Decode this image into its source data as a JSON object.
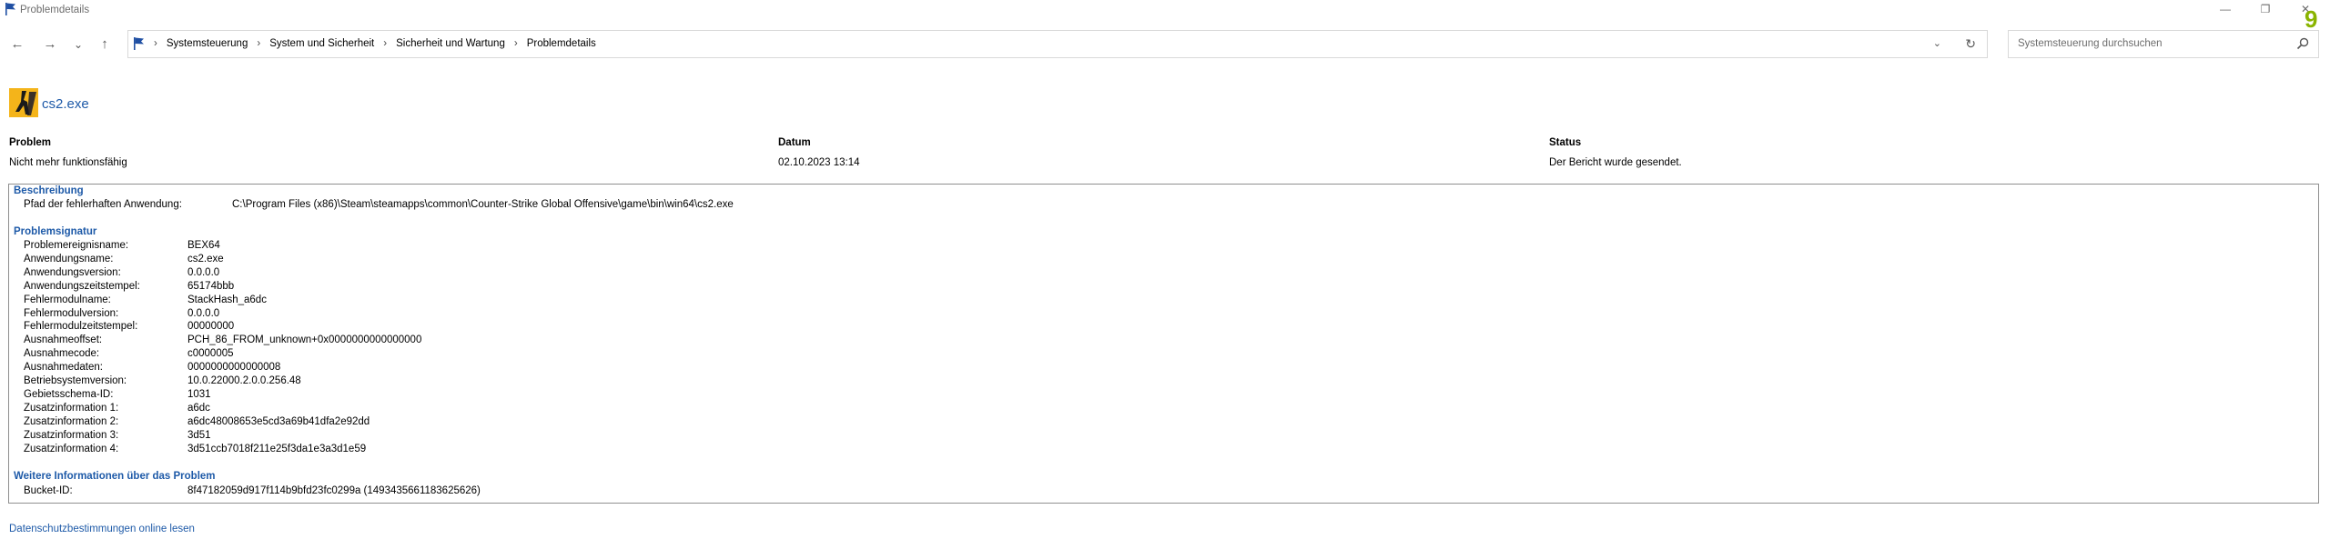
{
  "window": {
    "title": "Problemdetails",
    "minimize_glyph": "—",
    "maximize_glyph": "❐",
    "close_glyph": "✕",
    "badge": "9"
  },
  "nav": {
    "back_glyph": "←",
    "forward_glyph": "→",
    "recent_glyph": "⌄",
    "up_glyph": "↑",
    "breadcrumb": [
      "Systemsteuerung",
      "System und Sicherheit",
      "Sicherheit und Wartung",
      "Problemdetails"
    ],
    "separator": "›",
    "dropdown_glyph": "⌄",
    "refresh_glyph": "↻",
    "search_placeholder": "Systemsteuerung durchsuchen"
  },
  "app": {
    "name": "cs2.exe"
  },
  "summary": {
    "problem_header": "Problem",
    "problem_value": "Nicht mehr funktionsfähig",
    "date_header": "Datum",
    "date_value": "02.10.2023 13:14",
    "status_header": "Status",
    "status_value": "Der Bericht wurde gesendet."
  },
  "description": {
    "heading": "Beschreibung",
    "path_label": "Pfad der fehlerhaften Anwendung:",
    "path_value": "C:\\Program Files (x86)\\Steam\\steamapps\\common\\Counter-Strike Global Offensive\\game\\bin\\win64\\cs2.exe"
  },
  "signature": {
    "heading": "Problemsignatur",
    "rows": [
      {
        "label": "Problemereignisname:",
        "value": "BEX64"
      },
      {
        "label": "Anwendungsname:",
        "value": "cs2.exe"
      },
      {
        "label": "Anwendungsversion:",
        "value": "0.0.0.0"
      },
      {
        "label": "Anwendungszeitstempel:",
        "value": "65174bbb"
      },
      {
        "label": "Fehlermodulname:",
        "value": "StackHash_a6dc"
      },
      {
        "label": "Fehlermodulversion:",
        "value": "0.0.0.0"
      },
      {
        "label": "Fehlermodulzeitstempel:",
        "value": "00000000"
      },
      {
        "label": "Ausnahmeoffset:",
        "value": "PCH_86_FROM_unknown+0x0000000000000000"
      },
      {
        "label": "Ausnahmecode:",
        "value": "c0000005"
      },
      {
        "label": "Ausnahmedaten:",
        "value": "0000000000000008"
      },
      {
        "label": "Betriebsystemversion:",
        "value": "10.0.22000.2.0.0.256.48"
      },
      {
        "label": "Gebietsschema-ID:",
        "value": "1031"
      },
      {
        "label": "Zusatzinformation 1:",
        "value": "a6dc"
      },
      {
        "label": "Zusatzinformation 2:",
        "value": "a6dc48008653e5cd3a69b41dfa2e92dd"
      },
      {
        "label": "Zusatzinformation 3:",
        "value": "3d51"
      },
      {
        "label": "Zusatzinformation 4:",
        "value": "3d51ccb7018f211e25f3da1e3a3d1e59"
      }
    ]
  },
  "more_info": {
    "heading": "Weitere Informationen über das Problem",
    "bucket_label": "Bucket-ID:",
    "bucket_value": "8f47182059d917f114b9bfd23fc0299a (1493435661183625626)"
  },
  "footer": {
    "privacy_link": "Datenschutzbestimmungen online lesen"
  },
  "colors": {
    "link": "#1e5aa8",
    "flag_blue": "#1f4fa3",
    "app_icon_bg": "#f4b41a",
    "badge": "#8ab400"
  }
}
